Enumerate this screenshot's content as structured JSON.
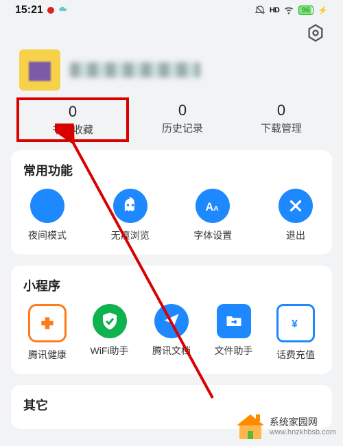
{
  "status": {
    "time": "15:21",
    "hd": "HD",
    "battery": "96"
  },
  "stats": {
    "bookmarks": {
      "num": "0",
      "label": "书签收藏"
    },
    "history": {
      "num": "0",
      "label": "历史记录"
    },
    "downloads": {
      "num": "0",
      "label": "下载管理"
    }
  },
  "sections": {
    "common": {
      "title": "常用功能",
      "items": [
        {
          "label": "夜间模式"
        },
        {
          "label": "无痕浏览"
        },
        {
          "label": "字体设置"
        },
        {
          "label": "退出"
        }
      ]
    },
    "miniapps": {
      "title": "小程序",
      "items": [
        {
          "label": "腾讯健康"
        },
        {
          "label": "WiFi助手"
        },
        {
          "label": "腾讯文档"
        },
        {
          "label": "文件助手"
        },
        {
          "label": "话费充值"
        }
      ]
    },
    "other": {
      "title": "其它"
    }
  },
  "watermark": {
    "cn": "系统家园网",
    "en": "www.hnzkhbsb.com"
  }
}
